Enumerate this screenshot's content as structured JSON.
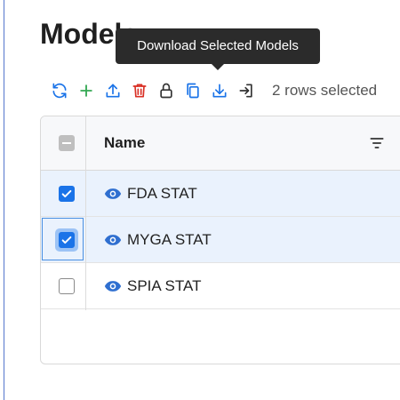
{
  "page": {
    "title": "Models"
  },
  "tooltip": {
    "text": "Download Selected Models"
  },
  "toolbar": {
    "buttons": [
      {
        "name": "refresh-icon",
        "color": "#1a73e8"
      },
      {
        "name": "add-icon",
        "color": "#34a853"
      },
      {
        "name": "upload-icon",
        "color": "#1a73e8"
      },
      {
        "name": "trash-icon",
        "color": "#d93025"
      },
      {
        "name": "lock-icon",
        "color": "#333333"
      },
      {
        "name": "copy-icon",
        "color": "#1a73e8"
      },
      {
        "name": "download-icon",
        "color": "#1a73e8"
      },
      {
        "name": "import-icon",
        "color": "#333333"
      }
    ],
    "selection_status": "2 rows selected"
  },
  "grid": {
    "header": {
      "name_label": "Name"
    },
    "rows": [
      {
        "name": "FDA STAT",
        "selected": true
      },
      {
        "name": "MYGA STAT",
        "selected": true,
        "focused": true
      },
      {
        "name": "SPIA STAT",
        "selected": false
      }
    ]
  },
  "colors": {
    "accent": "#1a73e8",
    "selected_row": "#eaf2fd",
    "tooltip_bg": "#2b2b2b",
    "danger": "#d93025",
    "success": "#34a853"
  }
}
